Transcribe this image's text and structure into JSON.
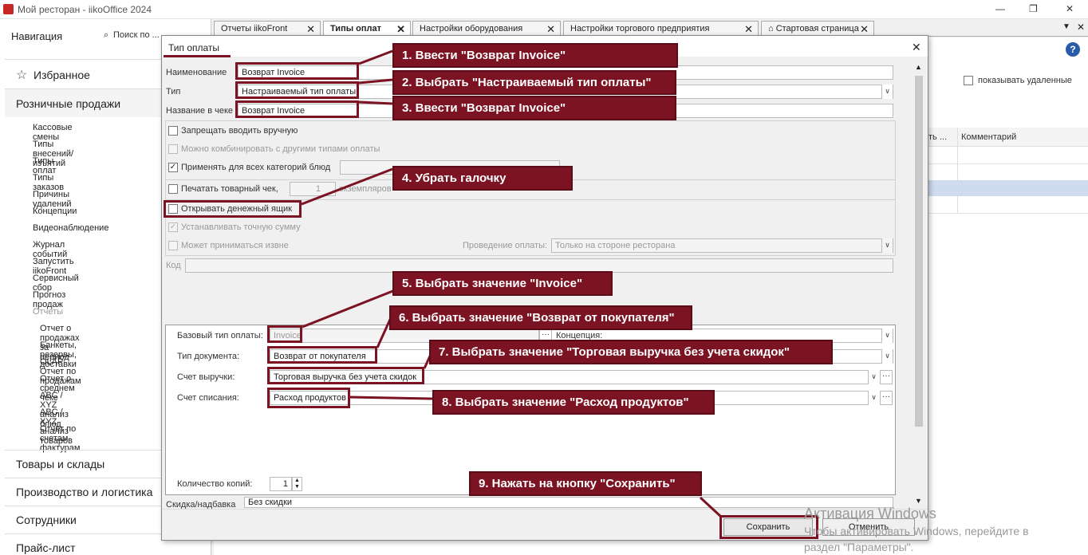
{
  "window": {
    "title": "Мой ресторан - iikoOffice 2024",
    "controls": [
      "—",
      "❐",
      "✕"
    ]
  },
  "sidebar": {
    "header": "Навигация",
    "search": "Поиск по ...",
    "favorites": "Избранное",
    "retail": "Розничные продажи",
    "items": [
      "Кассовые смены",
      "Типы внесений/изъятий",
      "Типы оплат",
      "Типы заказов",
      "Причины удалений",
      "Концепции",
      "Видеонаблюдение",
      "Журнал событий",
      "Запустить iikoFront",
      "Сервисный сбор",
      "Прогноз продаж",
      "Отчеты"
    ],
    "reports": [
      "Отчет о продажах за период",
      "Банкеты, резервы, доставки",
      "OLAP Отчет по продажам",
      "Отчет о среднем чеке",
      "ABC / XYZ анализ блюд",
      "ABC / XYZ анализ товаров",
      "Отчет по счетам-фактурам"
    ],
    "sections": [
      "Товары и склады",
      "Производство и логистика",
      "Сотрудники",
      "Прайс-лист"
    ]
  },
  "tabs": [
    {
      "label": "Отчеты iikoFront"
    },
    {
      "label": "Типы оплат"
    },
    {
      "label": "Настройки оборудования"
    },
    {
      "label": "Настройки торгового предприятия"
    },
    {
      "label": "Стартовая страница"
    }
  ],
  "main": {
    "show_deleted": "показывать удаленные",
    "col_partial": "ть ...",
    "col_comment": "Комментарий",
    "help": "?"
  },
  "dialog": {
    "title": "Тип оплаты",
    "name_label": "Наименование",
    "name_value": "Возврат Invoice",
    "type_label": "Тип",
    "type_value": "Настраиваемый тип оплаты",
    "receipt_label": "Название в чеке",
    "receipt_value": "Возврат Invoice",
    "cb_manual": "Запрещать вводить вручную",
    "cb_combine": "Можно комбинировать с другими типами оплаты",
    "cb_allcat": "Применять для всех категорий блюд",
    "cb_print": "Печатать товарный чек,",
    "print_count": "1",
    "print_suffix": "экземпляров",
    "cb_drawer": "Открывать денежный ящик",
    "cb_exact": "Устанавливать точную сумму",
    "cb_external": "Может приниматься извне",
    "payment_label": "Проведение оплаты:",
    "payment_value": "Только на стороне ресторана",
    "code_label": "Код",
    "base_type_label": "Базовый тип оплаты:",
    "base_type_value": "Invoice",
    "concept_label": "Концепция:",
    "doc_type_label": "Тип документа:",
    "doc_type_value": "Возврат от покупателя",
    "revenue_label": "Счет выручки:",
    "revenue_value": "Торговая выручка без учета скидок",
    "writeoff_label": "Счет списания:",
    "writeoff_value": "Расход продуктов",
    "copies_label": "Количество копий:",
    "copies_value": "1",
    "discount_label": "Скидка/надбавка",
    "discount_value": "Без скидки",
    "save": "Сохранить",
    "cancel": "Отменить",
    "close": "✕"
  },
  "callouts": [
    "1. Ввести \"Возврат Invoice\"",
    "2. Выбрать \"Настраиваемый тип оплаты\"",
    "3. Ввести \"Возврат Invoice\"",
    "4. Убрать галочку",
    "5. Выбрать значение \"Invoice\"",
    "6. Выбрать значение \"Возврат от покупателя\"",
    "7. Выбрать значение \"Торговая выручка без учета скидок\"",
    "8. Выбрать значение \"Расход продуктов\"",
    "9. Нажать на кнопку \"Сохранить\""
  ],
  "watermark": {
    "line1": "Активация Windows",
    "line2": "Чтобы активировать Windows, перейдите в",
    "line3": "раздел \"Параметры\"."
  },
  "colors": {
    "callout": "#7b1323",
    "selection": "#cfdcef"
  }
}
